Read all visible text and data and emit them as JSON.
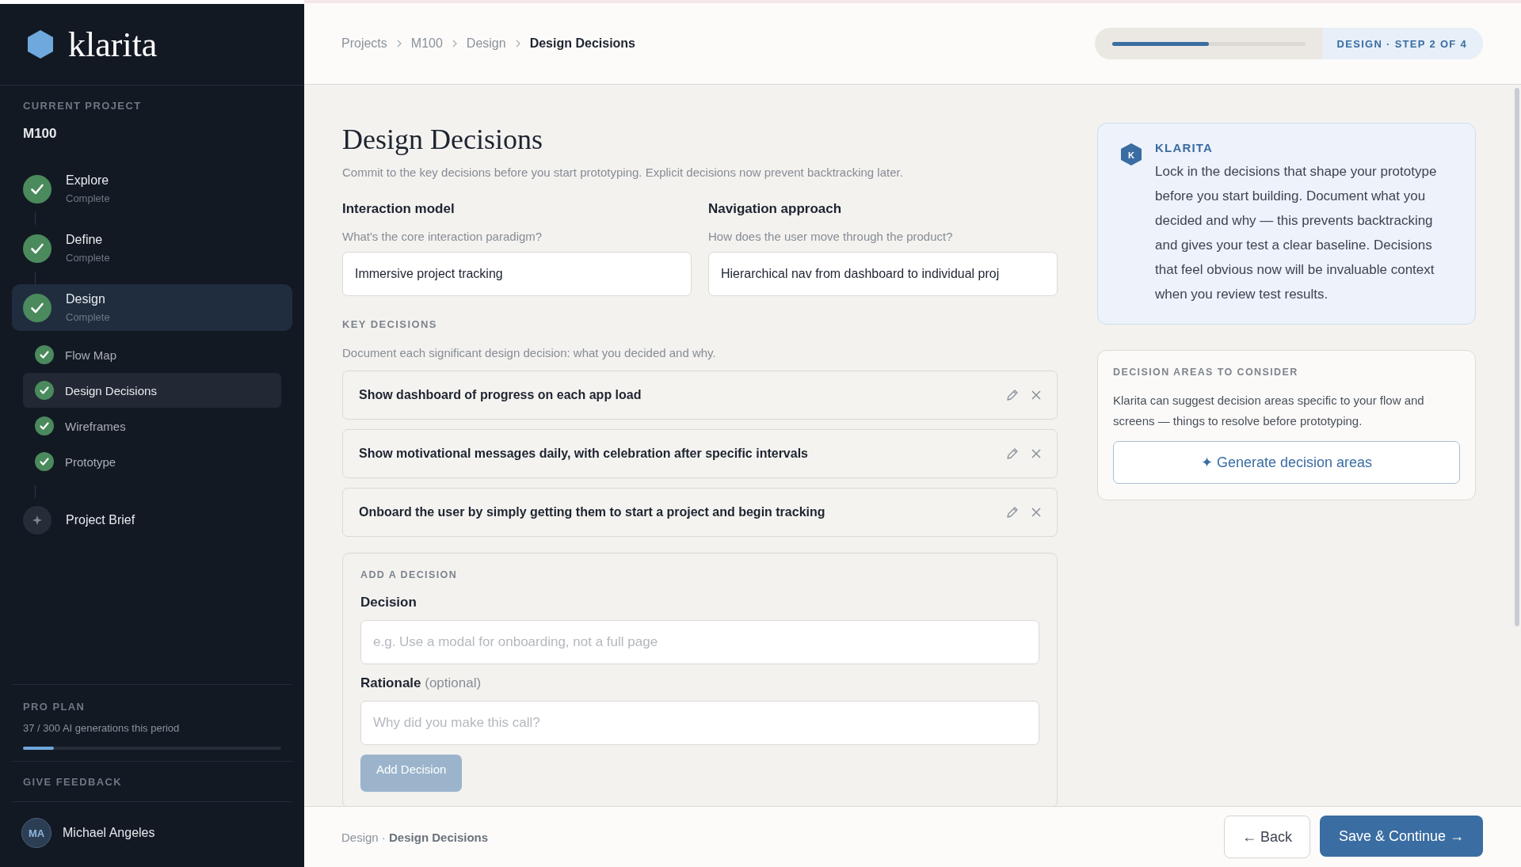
{
  "sidebar": {
    "logo": "klarita",
    "project_label": "CURRENT PROJECT",
    "project_name": "M100",
    "steps": [
      {
        "name": "Explore",
        "status": "Complete",
        "done": true,
        "selected": false
      },
      {
        "name": "Define",
        "status": "Complete",
        "done": true,
        "selected": false
      },
      {
        "name": "Design",
        "status": "Complete",
        "done": true,
        "selected": true,
        "children": [
          {
            "name": "Flow Map",
            "done": true,
            "selected": false
          },
          {
            "name": "Design Decisions",
            "done": true,
            "selected": true
          },
          {
            "name": "Wireframes",
            "done": true,
            "selected": false
          },
          {
            "name": "Prototype",
            "done": true,
            "selected": false
          }
        ]
      },
      {
        "name": "Project Brief",
        "done": false,
        "selected": false
      }
    ],
    "plan": {
      "label": "PRO PLAN",
      "usage": "37 / 300 AI generations this period",
      "level": 0.12
    },
    "feedback": "GIVE FEEDBACK",
    "user": {
      "initials": "MA",
      "name": "Michael Angeles"
    }
  },
  "header": {
    "breadcrumbs": [
      "Projects",
      "M100",
      "Design",
      "Design Decisions"
    ],
    "progress": {
      "level": 0.5,
      "label": "DESIGN · STEP 2 OF 4"
    }
  },
  "page": {
    "title": "Design Decisions",
    "subtitle": "Commit to the key decisions before you start prototyping. Explicit decisions now prevent backtracking later.",
    "fields": [
      {
        "label": "Interaction model",
        "hint": "What's the core interaction paradigm?",
        "value": "Immersive project tracking"
      },
      {
        "label": "Navigation approach",
        "hint": "How does the user move through the product?",
        "value": "Hierarchical nav from dashboard to individual proj"
      }
    ],
    "key_decisions": {
      "heading": "KEY DECISIONS",
      "description": "Document each significant design decision: what you decided and why.",
      "items": [
        "Show dashboard of progress on each app load",
        "Show motivational messages daily, with celebration after specific intervals",
        "Onboard the user by simply getting them to start a project and begin tracking"
      ]
    },
    "add_decision": {
      "heading": "ADD A DECISION",
      "decision_label": "Decision",
      "decision_placeholder": "e.g. Use a modal for onboarding, not a full page",
      "rationale_label": "Rationale",
      "rationale_note": "(optional)",
      "rationale_placeholder": "Why did you make this call?",
      "button": "Add Decision",
      "button_disabled": true
    }
  },
  "assistant": {
    "avatar": "K",
    "name": "KLARITA",
    "message": "Lock in the decisions that shape your prototype before you start building. Document what you decided and why — this prevents backtracking and gives your test a clear baseline. Decisions that feel obvious now will be invaluable context when you review test results."
  },
  "areas": {
    "heading": "DECISION AREAS TO CONSIDER",
    "description": "Klarita can suggest decision areas specific to your flow and screens — things to resolve before prototyping.",
    "button_icon": "✦",
    "button": "Generate decision areas"
  },
  "footer": {
    "section": "Design",
    "separator": "·",
    "page": "Design Decisions",
    "back": "← Back",
    "continue": "Save & Continue →"
  }
}
